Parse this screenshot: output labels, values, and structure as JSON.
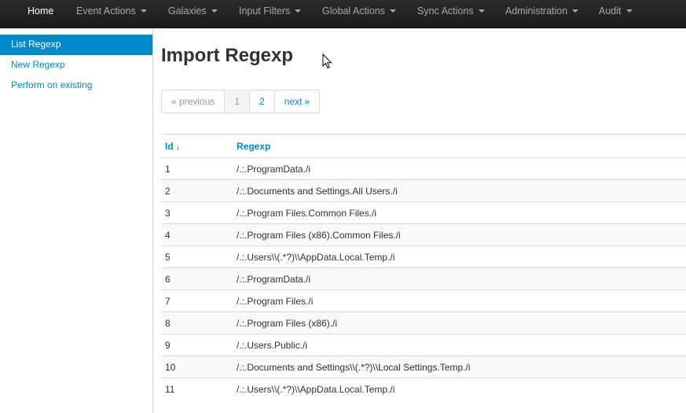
{
  "navbar": {
    "items": [
      {
        "label": "Home",
        "active": true,
        "dropdown": false
      },
      {
        "label": "Event Actions",
        "dropdown": true
      },
      {
        "label": "Galaxies",
        "dropdown": true
      },
      {
        "label": "Input Filters",
        "dropdown": true
      },
      {
        "label": "Global Actions",
        "dropdown": true
      },
      {
        "label": "Sync Actions",
        "dropdown": true
      },
      {
        "label": "Administration",
        "dropdown": true
      },
      {
        "label": "Audit",
        "dropdown": true
      }
    ]
  },
  "sidebar": {
    "items": [
      {
        "label": "List Regexp",
        "active": true
      },
      {
        "label": "New Regexp"
      },
      {
        "label": "Perform on existing"
      }
    ]
  },
  "page": {
    "title": "Import Regexp"
  },
  "pagination": {
    "previous": "« previous",
    "pages": [
      "1",
      "2"
    ],
    "current": "1",
    "next": "next »"
  },
  "table": {
    "headers": {
      "id": "Id",
      "sort_arrow": "↓",
      "regexp": "Regexp"
    },
    "rows": [
      {
        "id": "1",
        "regexp": "/.:.ProgramData./i"
      },
      {
        "id": "2",
        "regexp": "/.:.Documents and Settings.All Users./i"
      },
      {
        "id": "3",
        "regexp": "/.:.Program Files.Common Files./i"
      },
      {
        "id": "4",
        "regexp": "/.:.Program Files (x86).Common Files./i"
      },
      {
        "id": "5",
        "regexp": "/.:.Users\\\\(.*?)\\\\AppData.Local.Temp./i"
      },
      {
        "id": "6",
        "regexp": "/.:.ProgramData./i"
      },
      {
        "id": "7",
        "regexp": "/.:.Program Files./i"
      },
      {
        "id": "8",
        "regexp": "/.:.Program Files (x86)./i"
      },
      {
        "id": "9",
        "regexp": "/.:.Users.Public./i"
      },
      {
        "id": "10",
        "regexp": "/.:.Documents and Settings\\\\(.*?)\\\\Local Settings.Temp./i"
      },
      {
        "id": "11",
        "regexp": "/.:.Users\\\\(.*?)\\\\AppData.Local.Temp./i"
      }
    ]
  },
  "colors": {
    "navbar_bg": "#1b1b1b",
    "link": "#0088cc",
    "active_sidebar_bg": "#0088cc",
    "stripe": "#f9f9f9"
  }
}
